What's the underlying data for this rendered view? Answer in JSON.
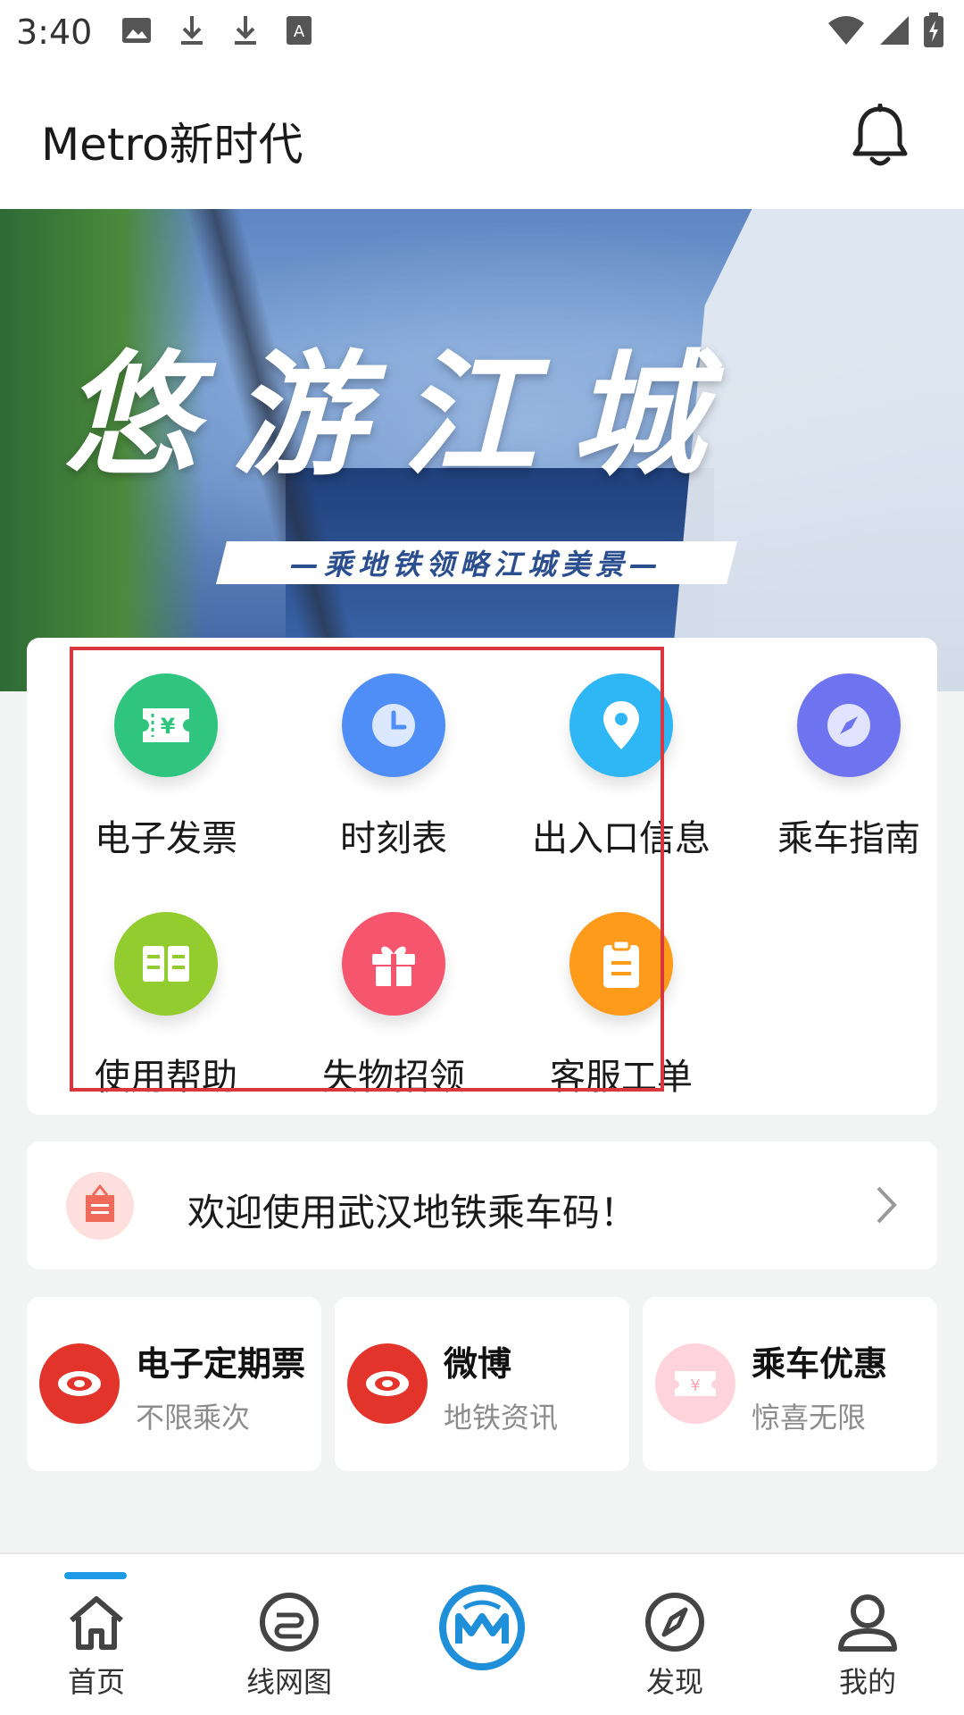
{
  "status_bar": {
    "time": "3:40",
    "left_icons": [
      "image-icon",
      "download-icon",
      "download-icon",
      "text-app-icon"
    ],
    "right_icons": [
      "wifi-icon",
      "cell-signal-icon",
      "battery-icon"
    ]
  },
  "header": {
    "title": "Metro新时代",
    "bell_icon": "bell-icon"
  },
  "banner": {
    "title": "悠游江城",
    "subtitle": "—乘地铁领略江城美景—"
  },
  "services": {
    "items": [
      {
        "label": "电子发票",
        "icon": "ticket-yen-icon",
        "color": "#2fc57e"
      },
      {
        "label": "时刻表",
        "icon": "clock-icon",
        "color": "#4f8ef7"
      },
      {
        "label": "出入口信息",
        "icon": "location-pin-icon",
        "color": "#2fb6f5"
      },
      {
        "label": "乘车指南",
        "icon": "compass-icon",
        "color": "#6e73ef"
      },
      {
        "label": "使用帮助",
        "icon": "book-icon",
        "color": "#93cc2e"
      },
      {
        "label": "失物招领",
        "icon": "gift-icon",
        "color": "#f6566d"
      },
      {
        "label": "客服工单",
        "icon": "clipboard-icon",
        "color": "#ff9b1a"
      }
    ]
  },
  "notice": {
    "text": "欢迎使用武汉地铁乘车码！",
    "icon": "notice-bag-icon"
  },
  "promos": [
    {
      "title": "电子定期票",
      "subtitle": "不限乘次",
      "icon": "flower-badge-icon",
      "color": "#e2342b"
    },
    {
      "title": "微博",
      "subtitle": "地铁资讯",
      "icon": "flower-badge-icon",
      "color": "#e2342b"
    },
    {
      "title": "乘车优惠",
      "subtitle": "惊喜无限",
      "icon": "coupon-icon",
      "color": "#ffd3dc"
    }
  ],
  "bottom_nav": {
    "active": "首页",
    "items": [
      {
        "label": "首页",
        "icon": "home-icon"
      },
      {
        "label": "线网图",
        "icon": "route-map-icon"
      },
      {
        "label": "",
        "icon": "metro-logo-icon"
      },
      {
        "label": "发现",
        "icon": "compass-icon"
      },
      {
        "label": "我的",
        "icon": "person-icon"
      }
    ],
    "accent": "#1e9be6"
  }
}
